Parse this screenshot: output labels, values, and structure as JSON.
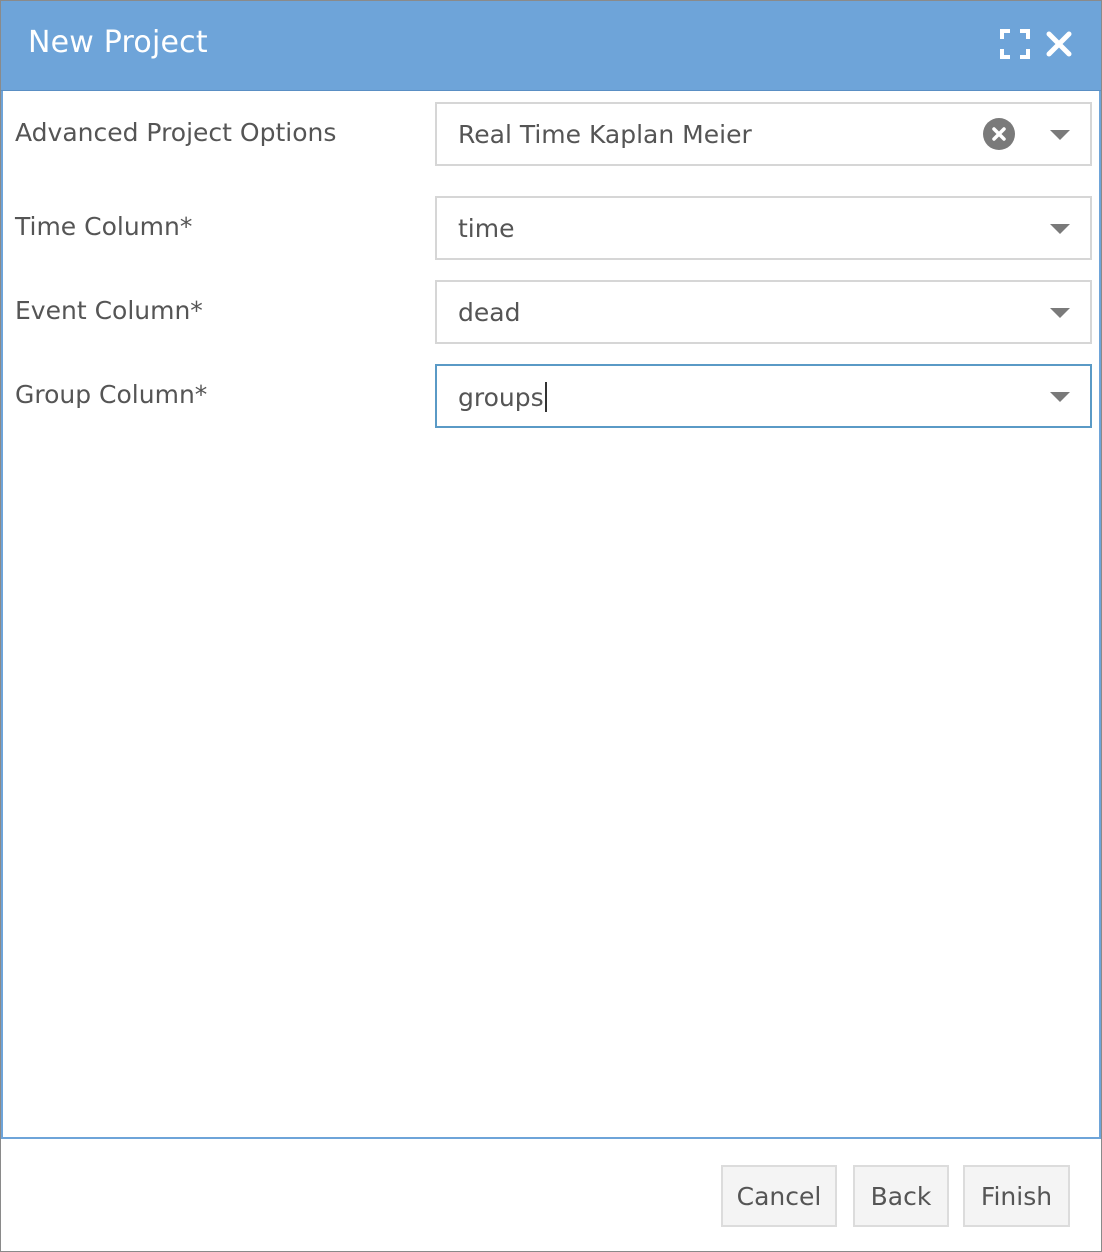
{
  "dialog": {
    "title": "New Project",
    "maximize_icon": "maximize-icon",
    "close_icon": "close-icon",
    "header_color": "#6ea4d9"
  },
  "form": {
    "advanced_options": {
      "label": "Advanced Project Options",
      "value": "Real Time Kaplan Meier"
    },
    "time_column": {
      "label": "Time Column*",
      "value": "time"
    },
    "event_column": {
      "label": "Event Column*",
      "value": "dead"
    },
    "group_column": {
      "label": "Group Column*",
      "value": "groups"
    }
  },
  "footer": {
    "cancel_label": "Cancel",
    "back_label": "Back",
    "finish_label": "Finish"
  }
}
